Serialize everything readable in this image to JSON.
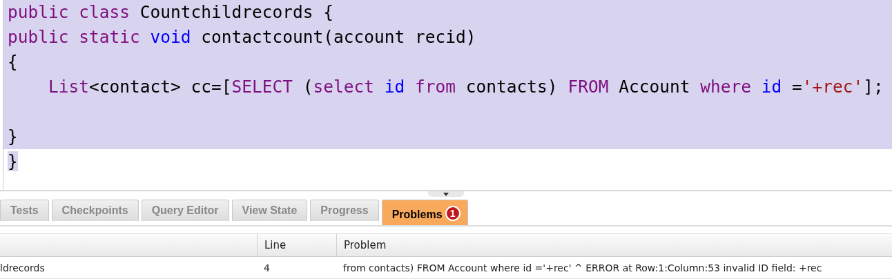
{
  "code": {
    "lines": [
      {
        "selected": true,
        "tokens": [
          {
            "text": "public",
            "kind": "keyword"
          },
          {
            "text": " class",
            "kind": "keyword"
          },
          {
            "text": " Countchildrecords {",
            "kind": "plain"
          }
        ]
      },
      {
        "selected": true,
        "tokens": [
          {
            "text": "public",
            "kind": "keyword"
          },
          {
            "text": " static",
            "kind": "keyword"
          },
          {
            "text": " void",
            "kind": "type"
          },
          {
            "text": " contactcount(account recid)",
            "kind": "plain"
          }
        ]
      },
      {
        "selected": true,
        "tokens": [
          {
            "text": "{",
            "kind": "plain"
          }
        ]
      },
      {
        "selected": true,
        "tokens": [
          {
            "text": "    List",
            "kind": "keyword"
          },
          {
            "text": "<contact> cc=[",
            "kind": "plain"
          },
          {
            "text": "SELECT",
            "kind": "keyword"
          },
          {
            "text": " (",
            "kind": "plain"
          },
          {
            "text": "select",
            "kind": "keyword"
          },
          {
            "text": " id",
            "kind": "type"
          },
          {
            "text": " from",
            "kind": "keyword"
          },
          {
            "text": " contacts) ",
            "kind": "plain"
          },
          {
            "text": "FROM",
            "kind": "keyword"
          },
          {
            "text": " Account ",
            "kind": "plain"
          },
          {
            "text": "where",
            "kind": "keyword"
          },
          {
            "text": " id",
            "kind": "type"
          },
          {
            "text": " =",
            "kind": "plain"
          },
          {
            "text": "'+rec'",
            "kind": "string"
          },
          {
            "text": "];",
            "kind": "plain"
          }
        ]
      },
      {
        "selected": true
      },
      {
        "selected": true,
        "tokens": [
          {
            "text": "}",
            "kind": "plain"
          }
        ]
      },
      {
        "selected": true,
        "tokens": [
          {
            "text": "}",
            "kind": "plain"
          }
        ]
      }
    ]
  },
  "tabs": [
    {
      "label": "Tests",
      "selected": false
    },
    {
      "label": "Checkpoints",
      "selected": false
    },
    {
      "label": "Query Editor",
      "selected": false
    },
    {
      "label": "View State",
      "selected": false
    },
    {
      "label": "Progress",
      "selected": false
    },
    {
      "label": "Problems",
      "selected": true,
      "badge": "1"
    }
  ],
  "table": {
    "columns": [
      {},
      {
        "label": "Line"
      },
      {
        "label": "Problem"
      }
    ],
    "rows": [
      [
        "ldrecords",
        "4",
        "from contacts) FROM Account where id ='+rec' ^ ERROR at Row:1:Column:53 invalid ID field: +rec"
      ]
    ]
  }
}
